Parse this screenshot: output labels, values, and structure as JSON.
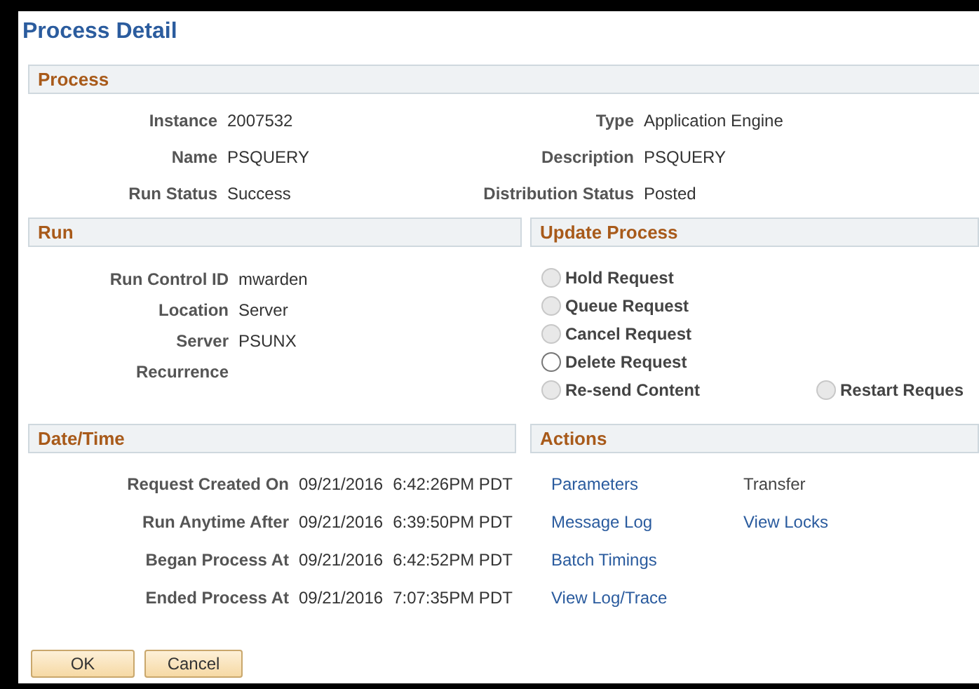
{
  "page_title": "Process Detail",
  "process": {
    "title": "Process",
    "left": [
      {
        "label": "Instance",
        "value": "2007532"
      },
      {
        "label": "Name",
        "value": "PSQUERY"
      },
      {
        "label": "Run Status",
        "value": "Success"
      }
    ],
    "right": [
      {
        "label": "Type",
        "value": "Application Engine"
      },
      {
        "label": "Description",
        "value": "PSQUERY"
      },
      {
        "label": "Distribution Status",
        "value": "Posted"
      }
    ]
  },
  "run": {
    "title": "Run",
    "fields": [
      {
        "label": "Run Control ID",
        "value": "mwarden"
      },
      {
        "label": "Location",
        "value": "Server"
      },
      {
        "label": "Server",
        "value": "PSUNX"
      },
      {
        "label": "Recurrence"
      }
    ]
  },
  "update_process": {
    "title": "Update Process",
    "options": [
      {
        "label": "Hold Request",
        "selected": false,
        "disabled": true
      },
      {
        "label": "Queue Request",
        "selected": false,
        "disabled": true
      },
      {
        "label": "Cancel Request",
        "selected": false,
        "disabled": true
      },
      {
        "label": "Delete Request",
        "selected": false,
        "disabled": false
      },
      {
        "label": "Re-send Content",
        "selected": false,
        "disabled": true
      }
    ],
    "extra_option": {
      "label": "Restart Reques",
      "selected": false,
      "disabled": true
    }
  },
  "date_time": {
    "title": "Date/Time",
    "rows": [
      {
        "label": "Request Created On",
        "date": "09/21/2016",
        "time": "6:42:26PM PDT"
      },
      {
        "label": "Run Anytime After",
        "date": "09/21/2016",
        "time": "6:39:50PM PDT"
      },
      {
        "label": "Began Process At",
        "date": "09/21/2016",
        "time": "6:42:52PM PDT"
      },
      {
        "label": "Ended Process At",
        "date": "09/21/2016",
        "time": "7:07:35PM PDT"
      }
    ]
  },
  "actions": {
    "title": "Actions",
    "columns": [
      [
        {
          "label": "Parameters",
          "disabled": false
        },
        {
          "label": "Message Log",
          "disabled": false
        },
        {
          "label": "Batch Timings",
          "disabled": false
        },
        {
          "label": "View Log/Trace",
          "disabled": false
        }
      ],
      [
        {
          "label": "Transfer",
          "disabled": true
        },
        {
          "label": "View Locks",
          "disabled": false
        }
      ]
    ]
  },
  "buttons": [
    "OK",
    "Cancel"
  ]
}
